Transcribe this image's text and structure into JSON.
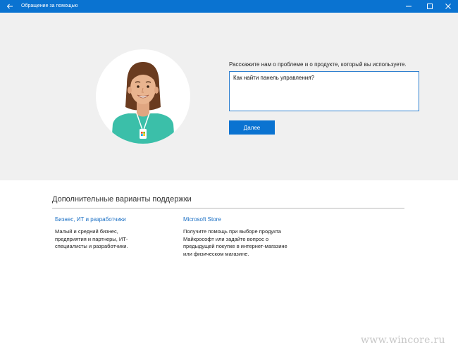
{
  "window": {
    "title": "Обращение за помощью",
    "icons": {
      "back": "back-arrow-icon",
      "minimize": "minimize-icon",
      "maximize": "maximize-icon",
      "close": "close-icon"
    }
  },
  "contact": {
    "prompt": "Расскажите нам о проблеме и о продукте, который вы используете.",
    "question_value": "Как найти панель управления?",
    "next_label": "Далее"
  },
  "more_options": {
    "title": "Дополнительные варианты поддержки",
    "options": [
      {
        "link": "Бизнес, ИТ и разработчики",
        "description": "Малый и средний бизнес, предприятия и партнеры, ИТ-специалисты и разработчики."
      },
      {
        "link": "Microsoft Store",
        "description": "Получите помощь при выборе продукта Майкрософт или задайте вопрос о предыдущей покупке в интернет-магазине или физическом магазине."
      }
    ]
  },
  "watermark": "www.wincore.ru",
  "colors": {
    "accent": "#0a73d1",
    "link": "#1a6fc4",
    "hero_bg": "#f0f0f0"
  }
}
